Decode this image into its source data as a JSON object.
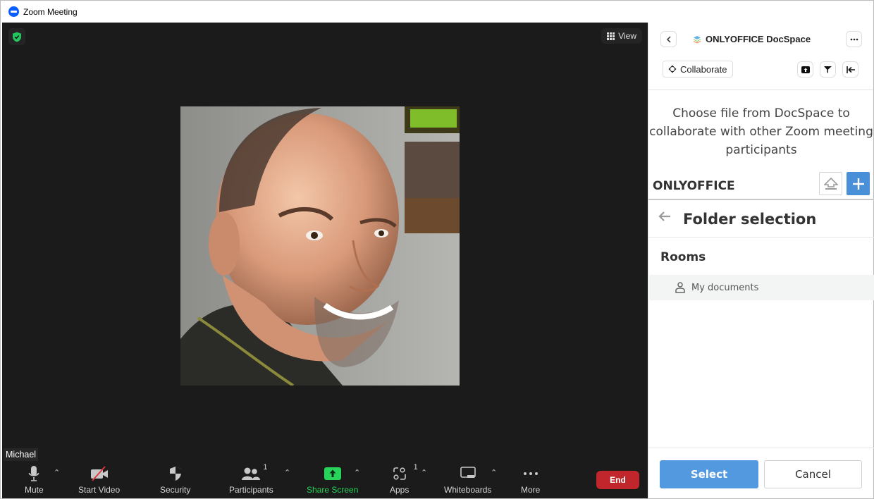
{
  "window": {
    "title": "Zoom Meeting"
  },
  "meeting": {
    "view_label": "View",
    "participant_name": "Michael",
    "toolbar": {
      "mute": "Mute",
      "start_video": "Start Video",
      "security": "Security",
      "participants": "Participants",
      "participants_count": "1",
      "share_screen": "Share Screen",
      "apps": "Apps",
      "apps_count": "1",
      "whiteboards": "Whiteboards",
      "more": "More",
      "end": "End"
    },
    "colors": {
      "share": "#27d35a",
      "end": "#c0262c",
      "secure": "#22c55e"
    }
  },
  "panel": {
    "app_title": "ONLYOFFICE DocSpace",
    "collaborate_label": "Collaborate",
    "description": "Choose file from DocSpace to collaborate with other Zoom meeting participants",
    "brand": "ONLYOFFICE",
    "folder_selection_title": "Folder selection",
    "section_label": "Rooms",
    "folders": [
      {
        "label": "My documents",
        "icon": "person-icon",
        "selected": true
      }
    ],
    "select_label": "Select",
    "cancel_label": "Cancel",
    "colors": {
      "primary": "#5299e0",
      "plus": "#4a90d9"
    }
  }
}
